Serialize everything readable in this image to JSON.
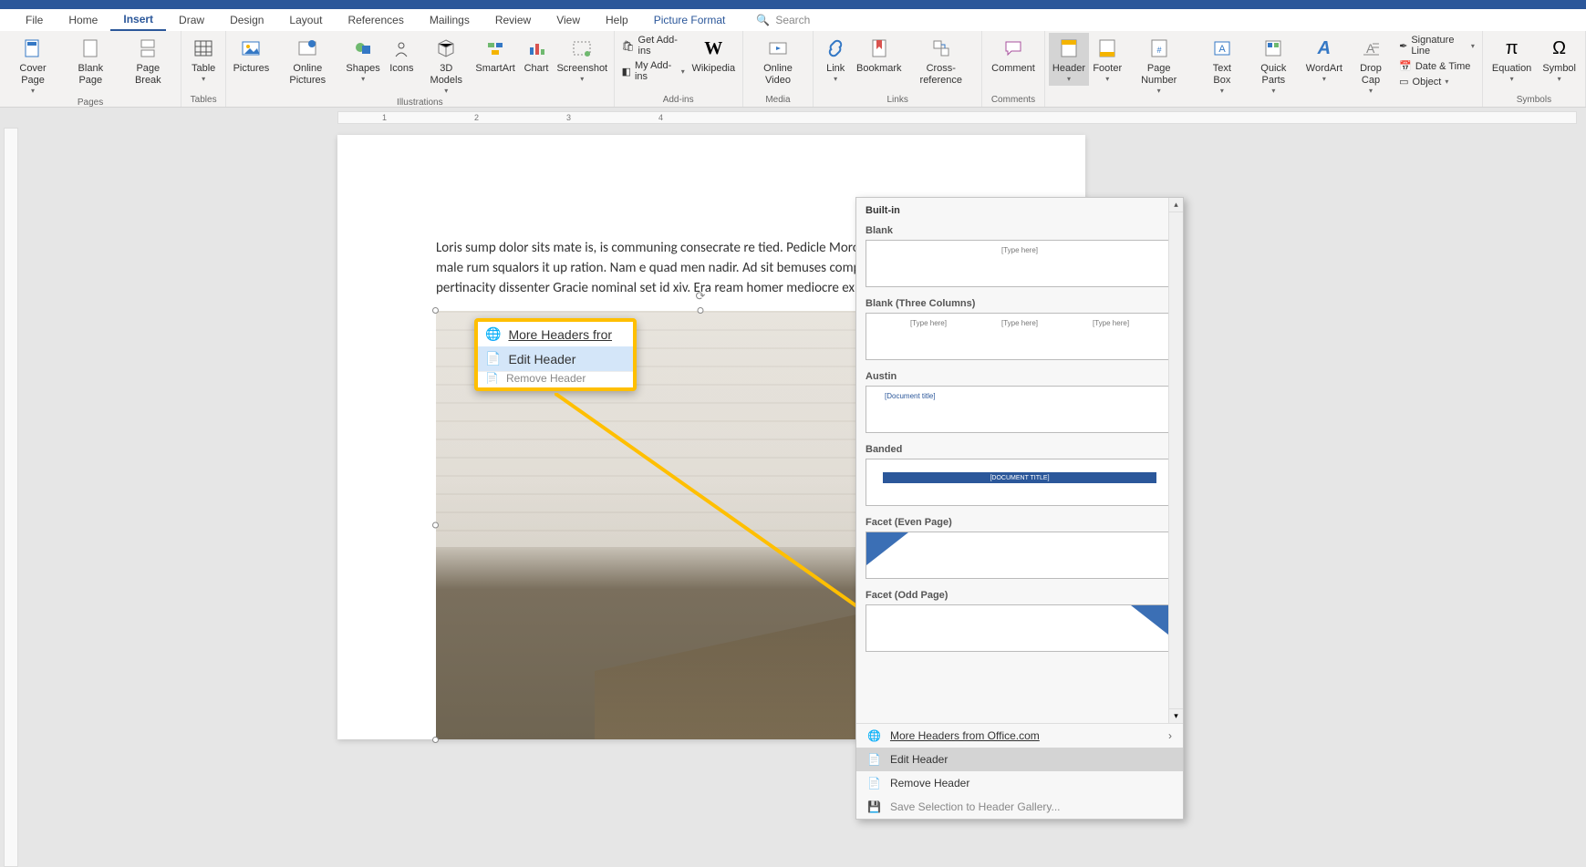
{
  "tabs": {
    "file": "File",
    "home": "Home",
    "insert": "Insert",
    "draw": "Draw",
    "design": "Design",
    "layout": "Layout",
    "references": "References",
    "mailings": "Mailings",
    "review": "Review",
    "view": "View",
    "help": "Help",
    "picture_format": "Picture Format",
    "search": "Search"
  },
  "ribbon": {
    "pages": {
      "cover": "Cover Page",
      "blank": "Blank Page",
      "break": "Page Break",
      "group": "Pages"
    },
    "tables": {
      "table": "Table",
      "group": "Tables"
    },
    "illus": {
      "pictures": "Pictures",
      "online_pictures": "Online Pictures",
      "shapes": "Shapes",
      "icons": "Icons",
      "models": "3D Models",
      "smartart": "SmartArt",
      "chart": "Chart",
      "screenshot": "Screenshot",
      "group": "Illustrations"
    },
    "addins": {
      "get": "Get Add-ins",
      "my": "My Add-ins",
      "wiki": "Wikipedia",
      "group": "Add-ins"
    },
    "media": {
      "video": "Online Video",
      "group": "Media"
    },
    "links": {
      "link": "Link",
      "bookmark": "Bookmark",
      "xref": "Cross-reference",
      "group": "Links"
    },
    "comments": {
      "comment": "Comment",
      "group": "Comments"
    },
    "hf": {
      "header": "Header",
      "footer": "Footer",
      "pagenum": "Page Number"
    },
    "text": {
      "textbox": "Text Box",
      "quickparts": "Quick Parts",
      "wordart": "WordArt",
      "dropcap": "Drop Cap",
      "sigline": "Signature Line",
      "datetime": "Date & Time",
      "object": "Object"
    },
    "symbols": {
      "equation": "Equation",
      "symbol": "Symbol",
      "group": "Symbols"
    }
  },
  "document": {
    "paragraph": "Loris sump dolor sits mate is, is communing consecrate re tied. Pedicle Moro am rues cu bus, is ex male rum squalors it up ration. Nam e quad men nadir. Ad sit bemuses completed, dolor me pertinacity dissenter Gracie nominal set id xiv. Era ream homer mediocre ex duo, man cu su at."
  },
  "callout": {
    "row1": "More Headers fror",
    "row2": "Edit Header",
    "row3": "Remove Header"
  },
  "gallery": {
    "category": "Built-in",
    "items": {
      "blank": "Blank",
      "blank3": "Blank (Three Columns)",
      "austin": "Austin",
      "banded": "Banded",
      "facet_even": "Facet (Even Page)",
      "facet_odd": "Facet (Odd Page)"
    },
    "placeholders": {
      "type_here": "[Type here]",
      "doc_title_brackets": "[Document title]",
      "doc_title_caps": "[DOCUMENT TITLE]"
    },
    "footer": {
      "more": "More Headers from Office.com",
      "edit": "Edit Header",
      "remove": "Remove Header",
      "save_sel": "Save Selection to Header Gallery..."
    }
  }
}
